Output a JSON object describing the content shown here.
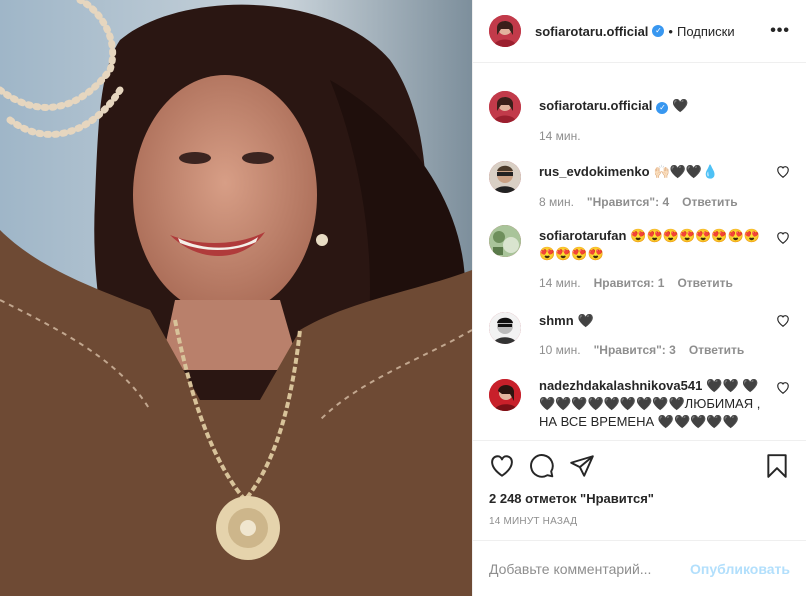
{
  "header": {
    "username": "sofiarotaru.official",
    "separator": "•",
    "follow_label": "Подписки",
    "more_icon": "more-horizontal-icon",
    "more_label": "•••"
  },
  "caption": {
    "username": "sofiarotaru.official",
    "text": "🖤",
    "time": "14 мин."
  },
  "comments": [
    {
      "username": "rus_evdokimenko",
      "text": "🙌🏻🖤🖤💧",
      "time": "8 мин.",
      "likes": "\"Нравится\": 4",
      "reply": "Ответить"
    },
    {
      "username": "sofiarotarufan",
      "text": "😍😍😍😍😍😍😍😍😍😍😍😍",
      "time": "14 мин.",
      "likes": "Нравится: 1",
      "reply": "Ответить"
    },
    {
      "username": "shmn",
      "text": "🖤",
      "time": "10 мин.",
      "likes": "\"Нравится\": 3",
      "reply": "Ответить"
    },
    {
      "username": "nadezhdakalashnikova541",
      "text": "🖤🖤 🖤🖤🖤🖤🖤🖤🖤🖤🖤🖤ЛЮБИМАЯ , НА ВСЕ ВРЕМЕНА 🖤🖤🖤🖤🖤",
      "time": "",
      "likes": "",
      "reply": ""
    }
  ],
  "actions": {
    "like_icon": "heart-icon",
    "comment_icon": "comment-icon",
    "share_icon": "paper-plane-icon",
    "save_icon": "bookmark-icon"
  },
  "likes_count": "2 248 отметок \"Нравится\"",
  "post_time": "14 МИНУТ НАЗАД",
  "add_comment": {
    "placeholder": "Добавьте комментарий...",
    "publish_label": "Опубликовать"
  },
  "colors": {
    "verified": "#3897f0",
    "publish_disabled": "#b2dffc",
    "meta_text": "#8e8e8e",
    "border": "#efefef"
  }
}
